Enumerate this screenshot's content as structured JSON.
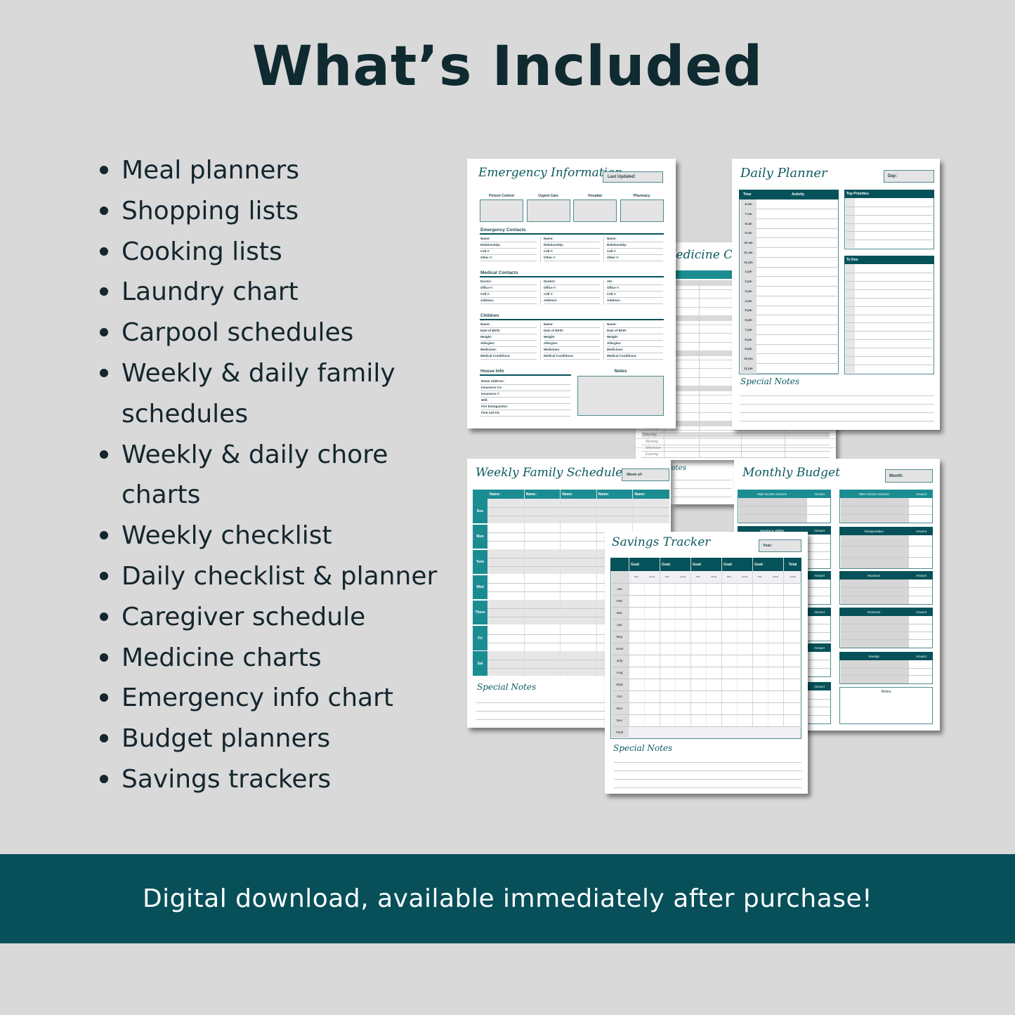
{
  "header": {
    "title": "What’s Included"
  },
  "features": [
    "Meal planners",
    "Shopping lists",
    "Cooking lists",
    "Laundry chart",
    "Carpool schedules",
    "Weekly & daily family schedules",
    "Weekly & daily chore charts",
    "Weekly checklist",
    "Daily checklist & planner",
    "Caregiver schedule",
    "Medicine charts",
    "Emergency info chart",
    "Budget planners",
    "Savings trackers"
  ],
  "banner": {
    "text": "Digital download, available immediately after purchase!"
  },
  "colors": {
    "background": "#d9d9d9",
    "banner": "#07505a",
    "teal_dark": "#06525a",
    "teal_mid": "#1b8d92",
    "title_text": "#0f2a30",
    "cell_gray": "#e4e4e4"
  },
  "pages": {
    "emergency": {
      "title": "Emergency Information",
      "last_updated": "Last Updated:",
      "boxes": [
        "Poison Control",
        "Urgent Care",
        "Hospital",
        "Pharmacy"
      ],
      "sections": [
        {
          "title": "Emergency Contacts",
          "columns": [
            [
              "Name:",
              "Relationship:",
              "Cell #:",
              "Other #:"
            ],
            [
              "Name:",
              "Relationship:",
              "Cell #:",
              "Other #:"
            ],
            [
              "Name:",
              "Relationship:",
              "Cell #:",
              "Other #:"
            ]
          ]
        },
        {
          "title": "Medical Contacts",
          "columns": [
            [
              "Doctor:",
              "Office #:",
              "Cell #:",
              "Address:"
            ],
            [
              "Dentist:",
              "Office #:",
              "Cell #:",
              "Address:"
            ],
            [
              "Vet:",
              "Office #:",
              "Cell #:",
              "Address:"
            ]
          ]
        },
        {
          "title": "Children",
          "columns": [
            [
              "Name:",
              "Date of Birth:",
              "Weight:",
              "Allergies:",
              "Medicines:",
              "Medical Conditions:"
            ],
            [
              "Name:",
              "Date of Birth:",
              "Weight:",
              "Allergies:",
              "Medicines:",
              "Medical Conditions:"
            ],
            [
              "Name:",
              "Date of Birth:",
              "Weight:",
              "Allergies:",
              "Medicines:",
              "Medical Conditions:"
            ]
          ]
        }
      ],
      "house_info": {
        "title": "House Info",
        "fields": [
          "Home Address:",
          "Insurance Co:",
          "Insurance #:",
          "Wifi:",
          "Fire Extinguisher:",
          "First Aid Kit:"
        ]
      },
      "notes": "Notes"
    },
    "daily": {
      "title": "Daily Planner",
      "day": "Day:",
      "time_header": "Time",
      "activity_header": "Activity",
      "times": [
        "6 am",
        "7 am",
        "8 am",
        "9 am",
        "10 am",
        "11 am",
        "12 pm",
        "1 pm",
        "2 pm",
        "3 pm",
        "4 pm",
        "5 pm",
        "6 pm",
        "7 pm",
        "8 pm",
        "9 pm",
        "10 pm",
        "11 pm"
      ],
      "top_priorities": "Top Priorities",
      "todos": "To Dos",
      "special_notes": "Special Notes"
    },
    "medicine": {
      "title": "Medicine Chart",
      "evening_prev": "Evening",
      "day": "Saturday",
      "periods": [
        "Morning",
        "Afternoon",
        "Evening"
      ]
    },
    "back_notes": {
      "title": "Notes"
    },
    "weekly": {
      "title": "Weekly Family Schedule",
      "week_of": "Week of:",
      "names": [
        "Name:",
        "Name:",
        "Name:",
        "Name:",
        "Name:"
      ],
      "days": [
        "Sun",
        "Mon",
        "Tues",
        "Wed",
        "Thurs",
        "Fri",
        "Sat"
      ],
      "special_notes": "Special Notes"
    },
    "budget": {
      "title": "Monthly Budget",
      "month": "Month:",
      "amount": "Amount",
      "left": [
        "Main Income Sources",
        "Housing & Utilities"
      ],
      "right": [
        "Other Income Sources",
        "Transportation",
        "Insurance",
        "Groceries",
        "Savings"
      ],
      "notes": "Notes"
    },
    "savings": {
      "title": "Savings Tracker",
      "year": "Year:",
      "goal": "Goal:",
      "total": "Total",
      "plan": "Plan",
      "actual": "Actual",
      "months": [
        "Jan",
        "Feb",
        "Mar",
        "Apr",
        "May",
        "June",
        "July",
        "Aug",
        "Sept",
        "Oct",
        "Nov",
        "Dec",
        "Total"
      ],
      "special_notes": "Special Notes"
    }
  }
}
